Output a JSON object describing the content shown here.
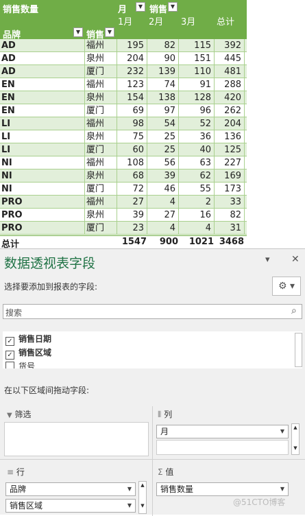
{
  "pivot": {
    "title": "销售数量",
    "col_field": "月",
    "col_field2": "销售",
    "row_field": "品牌",
    "row_field2": "销售",
    "months": [
      "1月",
      "2月",
      "3月"
    ],
    "total_label": "总计",
    "filter_glyph": "▼",
    "rows": [
      {
        "brand": "AD",
        "region": "福州",
        "m1": "195",
        "m2": "82",
        "m3": "115",
        "total": "392"
      },
      {
        "brand": "AD",
        "region": "泉州",
        "m1": "204",
        "m2": "90",
        "m3": "151",
        "total": "445"
      },
      {
        "brand": "AD",
        "region": "厦门",
        "m1": "232",
        "m2": "139",
        "m3": "110",
        "total": "481"
      },
      {
        "brand": "EN",
        "region": "福州",
        "m1": "123",
        "m2": "74",
        "m3": "91",
        "total": "288"
      },
      {
        "brand": "EN",
        "region": "泉州",
        "m1": "154",
        "m2": "138",
        "m3": "128",
        "total": "420"
      },
      {
        "brand": "EN",
        "region": "厦门",
        "m1": "69",
        "m2": "97",
        "m3": "96",
        "total": "262"
      },
      {
        "brand": "LI",
        "region": "福州",
        "m1": "98",
        "m2": "54",
        "m3": "52",
        "total": "204"
      },
      {
        "brand": "LI",
        "region": "泉州",
        "m1": "75",
        "m2": "25",
        "m3": "36",
        "total": "136"
      },
      {
        "brand": "LI",
        "region": "厦门",
        "m1": "60",
        "m2": "25",
        "m3": "40",
        "total": "125"
      },
      {
        "brand": "NI",
        "region": "福州",
        "m1": "108",
        "m2": "56",
        "m3": "63",
        "total": "227"
      },
      {
        "brand": "NI",
        "region": "泉州",
        "m1": "68",
        "m2": "39",
        "m3": "62",
        "total": "169"
      },
      {
        "brand": "NI",
        "region": "厦门",
        "m1": "72",
        "m2": "46",
        "m3": "55",
        "total": "173"
      },
      {
        "brand": "PRO",
        "region": "福州",
        "m1": "27",
        "m2": "4",
        "m3": "2",
        "total": "33"
      },
      {
        "brand": "PRO",
        "region": "泉州",
        "m1": "39",
        "m2": "27",
        "m3": "16",
        "total": "82"
      },
      {
        "brand": "PRO",
        "region": "厦门",
        "m1": "23",
        "m2": "4",
        "m3": "4",
        "total": "31"
      }
    ],
    "totals": {
      "label": "总计",
      "m1": "1547",
      "m2": "900",
      "m3": "1021",
      "total": "3468"
    }
  },
  "panel": {
    "title": "数据透视表字段",
    "dropdown_glyph": "▾",
    "close_glyph": "✕",
    "choose_label": "选择要添加到报表的字段:",
    "gear_glyph": "⚙ ▾",
    "search_placeholder": "搜索",
    "search_icon": "⌕",
    "fields": [
      {
        "label": "销售日期",
        "checked": "✓"
      },
      {
        "label": "销售区域",
        "checked": "✓"
      },
      {
        "label": "货号",
        "checked": ""
      }
    ],
    "drag_label": "在以下区域间拖动字段:",
    "areas": {
      "filter": {
        "icon": "▼",
        "label": "筛选"
      },
      "columns": {
        "icon": "⦀",
        "label": "列",
        "items": [
          "月"
        ]
      },
      "rows": {
        "icon": "≡",
        "label": "行",
        "items": [
          "品牌",
          "销售区域"
        ]
      },
      "values": {
        "icon": "Σ",
        "label": "值",
        "items": [
          "销售数量"
        ]
      }
    },
    "watermark": "@51CTO博客"
  },
  "colors": {
    "header_green": "#70ad47",
    "band_green": "#e2efda",
    "title_green": "#217346"
  }
}
